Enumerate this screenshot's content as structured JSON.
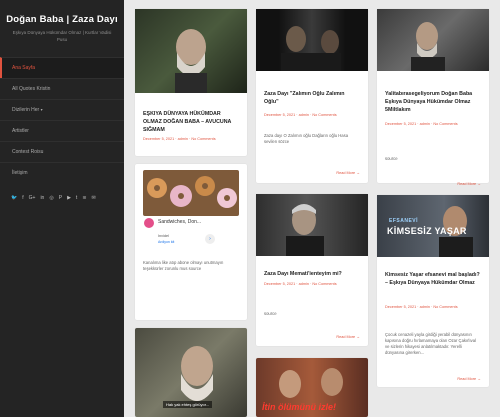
{
  "site": {
    "title": "Doğan Baba | Zaza Dayı",
    "tagline": "Eşkıya Dünyaya Hükümdar Olmaz | Kurtlar Vadisi Pusu"
  },
  "nav": [
    "Ana Sayfa",
    "All Quotes Kristin",
    "Dizilerin Her",
    "Artistler",
    "Contest Roisu",
    "İletişim"
  ],
  "social_icons": [
    "twitter-icon",
    "facebook-icon",
    "google-plus-icon",
    "linkedin-icon",
    "instagram-icon",
    "pinterest-icon",
    "youtube-icon",
    "tumblr-icon",
    "rss-icon",
    "mail-icon"
  ],
  "colors": {
    "accent": "#e0533f",
    "sidebar": "#242424",
    "page": "#e9e9e9"
  },
  "cards": {
    "c1": {
      "title": "EŞKIYA DÜNYAYA HÜKÜMDAR OLMAZ DOĞAN BABA – AVUCUNA SIĞMAM",
      "meta": "December 5, 2021 · admin · No Comments"
    },
    "c2": {
      "title": "Zaza Dayı \"Zalımın Oğlu Zalımın Oğlu\"",
      "meta": "December 5, 2021 · admin · No Comments",
      "excerpt": "Zaza dayı O Zalımın oğlu Dağların oğlu Hasa sevilen sözce",
      "more": "Read More →"
    },
    "c3": {
      "title": "Yalitabırasegeliyorum Doğan Baba Eşkıya Dünyaya Hükümdar Olmaz 5Miltlakım",
      "meta": "December 5, 2021 · admin · No Comments",
      "excerpt": "source",
      "more": "Read More →"
    },
    "c4": {
      "ad_title": "Sandwiches, Don...",
      "ad_meta": "Invidel",
      "ad_sub": "Ardiyon kit",
      "excerpt": "Kanalıma like atıp abone olmayı unutmayın teşekkürler zorunlu mus source"
    },
    "c5": {
      "title": "Zaza Dayı Memati'ienteyim mi?",
      "meta": "December 5, 2021 · admin · No Comments",
      "excerpt": "source",
      "more": "Read More →"
    },
    "c6": {
      "banner_top": "EFSANEVİ",
      "banner_main": "KİMSESİZ YAŞAR",
      "title": "Kimsesiz Yaşar efsanevi mal başladı? – Eşkıya Dünyaya Hükümdar Olmaz",
      "meta": "December 5, 2021 · admin · No Comments",
      "excerpt": "Çocuk cenazeli yayla girdiği yerabil dünyasının kapısına doğru hırlamamaya olan Ozar Çakırlıval ve sizlerin hikayesi anlatılmaktadır. Yerelli dünyasına girerken...",
      "more": "Read More →"
    },
    "c7": {
      "caption": "Hak yak ehteş görüyor..."
    },
    "c8": {
      "banner": "İtin ölümünü izle!"
    }
  }
}
